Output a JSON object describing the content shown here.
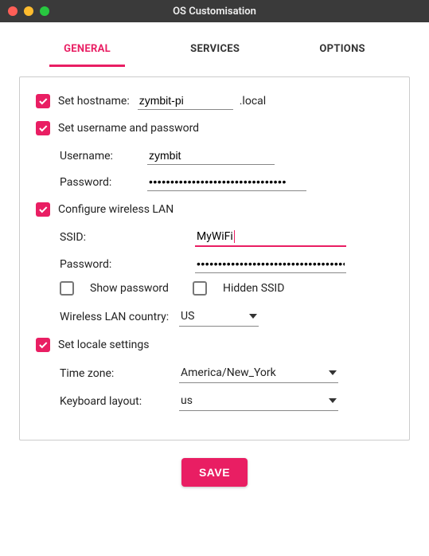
{
  "window": {
    "title": "OS Customisation"
  },
  "tabs": {
    "general": "GENERAL",
    "services": "SERVICES",
    "options": "OPTIONS"
  },
  "hostname": {
    "checkbox_label": "Set hostname:",
    "value": "zymbit-pi",
    "suffix": ".local"
  },
  "userpass": {
    "checkbox_label": "Set username and password",
    "username_label": "Username:",
    "username_value": "zymbit",
    "password_label": "Password:",
    "password_value": "••••••••••••••••••••••••••••••••"
  },
  "wifi": {
    "checkbox_label": "Configure wireless LAN",
    "ssid_label": "SSID:",
    "ssid_value": "MyWiFi",
    "password_label": "Password:",
    "password_value": "•••••••••••••••••••••••••••••••••••••",
    "show_password_label": "Show password",
    "hidden_ssid_label": "Hidden SSID",
    "country_label": "Wireless LAN country:",
    "country_value": "US"
  },
  "locale": {
    "checkbox_label": "Set locale settings",
    "timezone_label": "Time zone:",
    "timezone_value": "America/New_York",
    "keyboard_label": "Keyboard layout:",
    "keyboard_value": "us"
  },
  "footer": {
    "save_label": "Save"
  }
}
